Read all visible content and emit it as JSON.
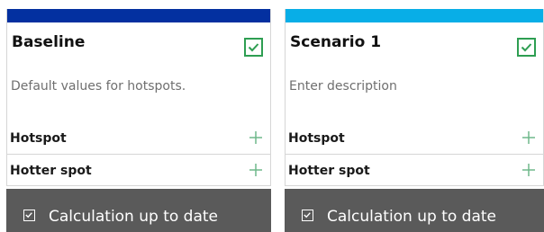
{
  "scenarios": [
    {
      "title": "Baseline",
      "description": "Default values for hotspots.",
      "accent_color": "#0330a0",
      "checked": true,
      "rows": [
        {
          "label": "Hotspot",
          "action_icon": "plus-icon"
        },
        {
          "label": "Hotter spot",
          "action_icon": "plus-icon"
        }
      ],
      "status": "Calculation up to date",
      "status_icon": "checkbox-checked-icon"
    },
    {
      "title": "Scenario 1",
      "description": "Enter description",
      "accent_color": "#08aee7",
      "checked": true,
      "rows": [
        {
          "label": "Hotspot",
          "action_icon": "plus-icon"
        },
        {
          "label": "Hotter spot",
          "action_icon": "plus-icon"
        }
      ],
      "status": "Calculation up to date",
      "status_icon": "checkbox-checked-icon"
    }
  ],
  "colors": {
    "check_green": "#2e9e52",
    "plus_green": "#6fb88a",
    "status_bg": "#5a5a5a"
  }
}
